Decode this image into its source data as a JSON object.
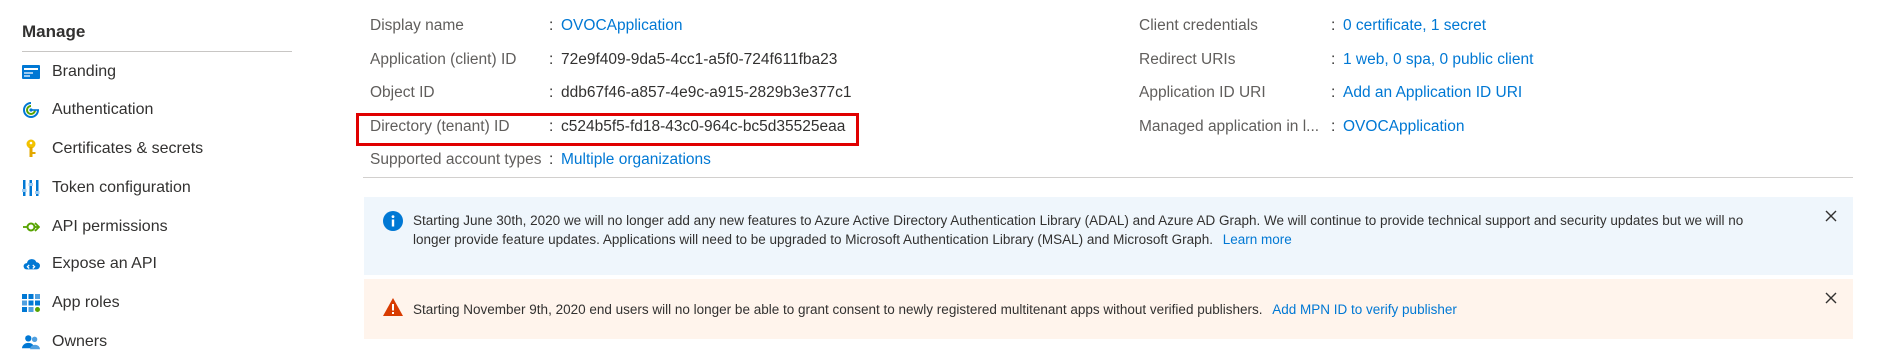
{
  "sidebar": {
    "title": "Manage",
    "items": [
      {
        "label": "Branding",
        "icon": "branding-icon"
      },
      {
        "label": "Authentication",
        "icon": "authentication-icon"
      },
      {
        "label": "Certificates & secrets",
        "icon": "key-icon"
      },
      {
        "label": "Token configuration",
        "icon": "token-config-icon"
      },
      {
        "label": "API permissions",
        "icon": "api-permissions-icon"
      },
      {
        "label": "Expose an API",
        "icon": "cloud-api-icon"
      },
      {
        "label": "App roles",
        "icon": "app-roles-icon"
      },
      {
        "label": "Owners",
        "icon": "owners-icon"
      }
    ]
  },
  "essentials": {
    "left": [
      {
        "label": "Display name",
        "value": "OVOCApplication",
        "is_link": true
      },
      {
        "label": "Application (client) ID",
        "value": "72e9f409-9da5-4cc1-a5f0-724f611fba23",
        "is_link": false
      },
      {
        "label": "Object ID",
        "value": "ddb67f46-a857-4e9c-a915-2829b3e377c1",
        "is_link": false
      },
      {
        "label": "Directory (tenant) ID",
        "value": "c524b5f5-fd18-43c0-964c-bc5d35525eaa",
        "is_link": false
      },
      {
        "label": "Supported account types",
        "value": "Multiple organizations",
        "is_link": true
      }
    ],
    "right": [
      {
        "label": "Client credentials",
        "value": "0 certificate, 1 secret",
        "is_link": true
      },
      {
        "label": "Redirect URIs",
        "value": "1 web, 0 spa, 0 public client",
        "is_link": true
      },
      {
        "label": "Application ID URI",
        "value": "Add an Application ID URI",
        "is_link": true
      },
      {
        "label": "Managed application in l...",
        "value": "OVOCApplication",
        "is_link": true
      }
    ],
    "colon": ":"
  },
  "banners": {
    "info": {
      "line1": "Starting June 30th, 2020 we will no longer add any new features to Azure Active Directory Authentication Library (ADAL) and Azure AD Graph. We will continue to provide technical support and security updates but we will no",
      "line2": "longer provide feature updates. Applications will need to be upgraded to Microsoft Authentication Library (MSAL) and Microsoft Graph.",
      "link": "Learn more"
    },
    "warning": {
      "text": "Starting November 9th, 2020 end users will no longer be able to grant consent to newly registered multitenant apps without verified publishers.",
      "link": "Add MPN ID to verify publisher"
    }
  },
  "colors": {
    "link": "#0078d4",
    "highlight": "#e00000",
    "info_bg": "#eff6fc",
    "warning_bg": "#fff4ec",
    "warning_icon": "#d83b01"
  }
}
